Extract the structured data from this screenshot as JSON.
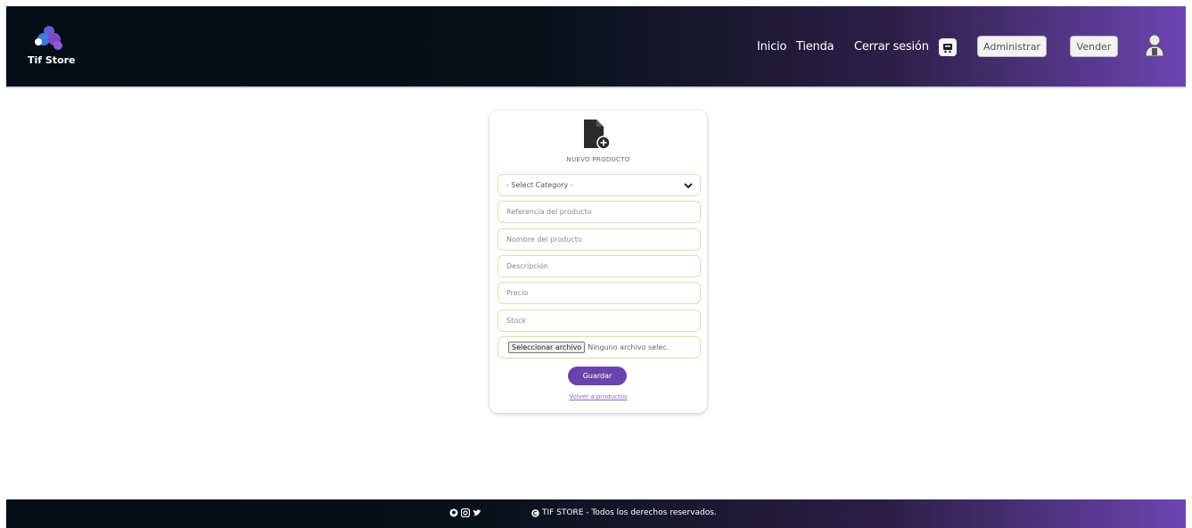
{
  "brand": {
    "name": "Tif Store",
    "logo_icon": "logo-icon"
  },
  "nav": {
    "inicio": "Inicio",
    "tienda": "Tienda",
    "cerrar_sesion": "Cerrar sesión",
    "cart_icon": "cart-icon",
    "administrar": "Administrar",
    "vender": "Vender",
    "user_icon": "user-icon"
  },
  "form": {
    "icon": "file-add-icon",
    "title": "NUEVO PRODUCTO",
    "category_select": {
      "selected": "- Select Category -"
    },
    "reference": {
      "placeholder": "Referencia del producto"
    },
    "name": {
      "placeholder": "Nombre del producto"
    },
    "description": {
      "placeholder": "Descripción"
    },
    "price": {
      "placeholder": "Precio"
    },
    "stock": {
      "placeholder": "Stock"
    },
    "file": {
      "button": "Seleccionar archivo",
      "status": "Ninguno archivo selec."
    },
    "save_label": "Guardar",
    "back_link": "Volver a productos"
  },
  "footer": {
    "social_icons": [
      "github-icon",
      "instagram-icon",
      "twitter-icon"
    ],
    "copyright": "TIF STORE - Todos los derechos reservados."
  },
  "colors": {
    "accent": "#6a44ad",
    "header_dark": "#040d16",
    "header_purple": "#6d45b1",
    "field_border": "#e7d9b0"
  }
}
